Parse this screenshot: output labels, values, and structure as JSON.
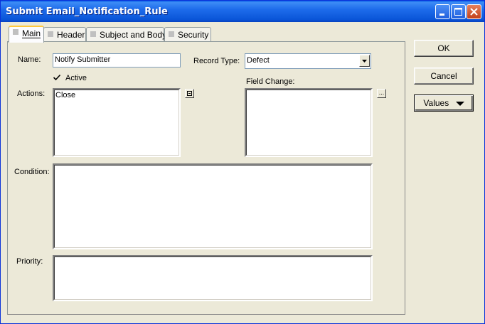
{
  "window": {
    "title": "Submit Email_Notification_Rule"
  },
  "tabs": [
    {
      "label": "Main",
      "active": true
    },
    {
      "label": "Header",
      "active": false
    },
    {
      "label": "Subject and Body",
      "active": false
    },
    {
      "label": "Security",
      "active": false
    }
  ],
  "main": {
    "name_label": "Name:",
    "name_value": "Notify Submitter",
    "record_type_label": "Record Type:",
    "record_type_value": "Defect",
    "active_label": "Active",
    "active_checked": true,
    "actions_label": "Actions:",
    "actions_items": [
      "Close"
    ],
    "actions_button": "…",
    "field_change_label": "Field Change:",
    "field_change_button": "...",
    "condition_label": "Condition:",
    "priority_label": "Priority:"
  },
  "buttons": {
    "ok": "OK",
    "cancel": "Cancel",
    "values": "Values"
  },
  "icons": {
    "minimize": "minimize-icon",
    "maximize": "maximize-icon",
    "close": "close-icon",
    "dropdown": "chevron-down-icon",
    "checkbox": "checkmark-icon"
  }
}
